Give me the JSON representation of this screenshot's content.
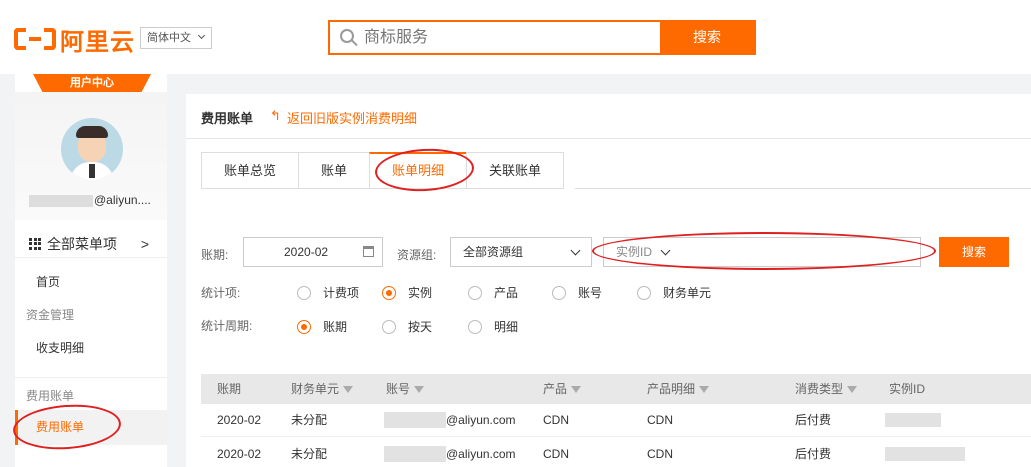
{
  "header": {
    "logo_text": "阿里云",
    "language": "简体中文",
    "search_placeholder": "商标服务",
    "search_button": "搜索"
  },
  "sidebar": {
    "badge": "用户中心",
    "email_suffix": "@aliyun....",
    "all_menu": "全部菜单项",
    "home": "首页",
    "category_funds": "资金管理",
    "income_expense": "收支明细",
    "category_billing": "费用账单",
    "billing_active": "费用账单"
  },
  "main": {
    "title": "费用账单",
    "back_link": "返回旧版实例消费明细",
    "tabs": [
      "账单总览",
      "账单",
      "账单明细",
      "关联账单"
    ],
    "active_tab": "账单明细",
    "filters": {
      "period_label": "账期:",
      "period_value": "2020-02",
      "group_label": "资源组:",
      "group_value": "全部资源组",
      "instance_select": "实例ID",
      "search_button": "搜索",
      "stat_item_label": "统计项:",
      "stat_items": [
        "计费项",
        "实例",
        "产品",
        "账号",
        "财务单元"
      ],
      "stat_item_selected": "实例",
      "stat_period_label": "统计周期:",
      "stat_periods": [
        "账期",
        "按天",
        "明细"
      ],
      "stat_period_selected": "账期"
    },
    "table": {
      "headers": [
        "账期",
        "财务单元",
        "账号",
        "产品",
        "产品明细",
        "消费类型",
        "实例ID"
      ],
      "rows": [
        [
          "2020-02",
          "未分配",
          "@aliyun.com",
          "CDN",
          "CDN",
          "后付费",
          ""
        ],
        [
          "2020-02",
          "未分配",
          "@aliyun.com",
          "CDN",
          "CDN",
          "后付费",
          ""
        ]
      ]
    }
  },
  "colors": {
    "accent": "#ff6a00",
    "annotation": "#e02020"
  }
}
